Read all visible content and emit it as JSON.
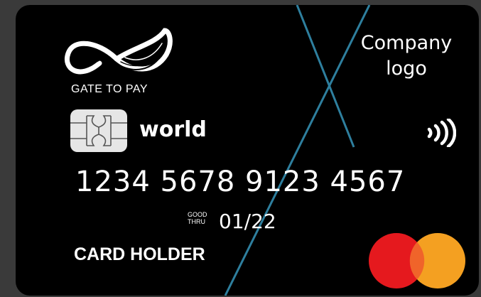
{
  "card": {
    "brand_name": "GATE TO PAY",
    "company_logo_line1": "Company",
    "company_logo_line2": "logo",
    "network_name": "world",
    "number": "1234 5678 9123 4567",
    "good_label_top": "GOOD",
    "good_label_bottom": "THRU",
    "expiry": "01/22",
    "holder": "CARD HOLDER"
  },
  "icons": {
    "brand_logo": "infinity-swirl-icon",
    "chip": "emv-chip-icon",
    "contactless": "contactless-icon",
    "network": "mastercard-icon"
  },
  "colors": {
    "card_background": "#000000",
    "page_background": "#3a3a3a",
    "text": "#ffffff",
    "accent_lines": "#2e7f9e",
    "chip": "#e6e6e6",
    "mastercard_red": "#e5191e",
    "mastercard_orange": "#f4a021",
    "mastercard_overlap": "#f0642a"
  }
}
